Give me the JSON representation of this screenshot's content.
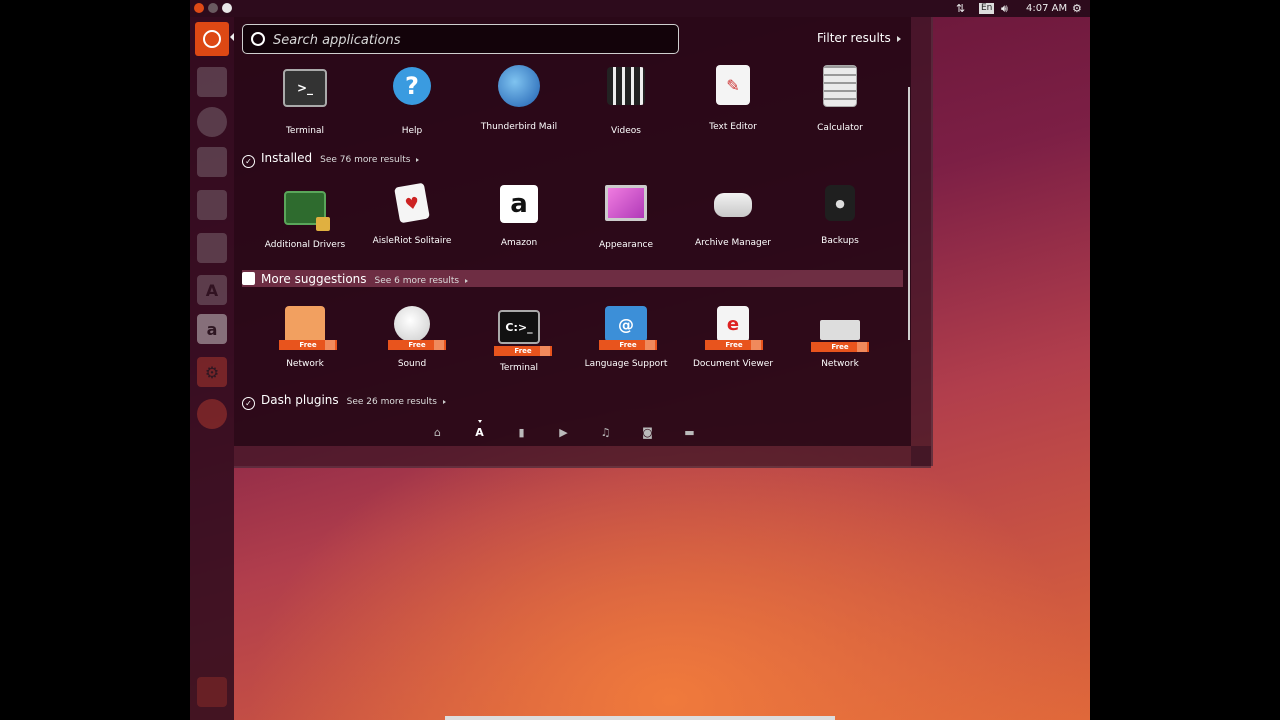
{
  "top_panel": {
    "language": "En",
    "time": "4:07 AM"
  },
  "dash": {
    "search": {
      "placeholder": "Search applications"
    },
    "filter_label": "Filter results",
    "recent_apps": [
      {
        "label": "Terminal",
        "icon": "terminal-icon"
      },
      {
        "label": "Help",
        "icon": "help-icon"
      },
      {
        "label": "Thunderbird Mail",
        "icon": "thunderbird-icon"
      },
      {
        "label": "Videos",
        "icon": "videos-icon"
      },
      {
        "label": "Text Editor",
        "icon": "text-editor-icon"
      },
      {
        "label": "Calculator",
        "icon": "calculator-icon"
      }
    ],
    "installed": {
      "title": "Installed",
      "see_more": "See 76 more results",
      "apps": [
        {
          "label": "Additional Drivers",
          "icon": "chip-icon"
        },
        {
          "label": "AisleRiot Solitaire",
          "icon": "cards-icon"
        },
        {
          "label": "Amazon",
          "icon": "amazon-icon"
        },
        {
          "label": "Appearance",
          "icon": "appearance-icon"
        },
        {
          "label": "Archive Manager",
          "icon": "archive-icon"
        },
        {
          "label": "Backups",
          "icon": "backups-icon"
        }
      ]
    },
    "suggestions": {
      "title": "More suggestions",
      "see_more": "See 6 more results",
      "badge": "Free",
      "apps": [
        {
          "label": "Network",
          "icon": "network-icon"
        },
        {
          "label": "Sound",
          "icon": "sound-icon"
        },
        {
          "label": "Terminal",
          "icon": "terminal-icon"
        },
        {
          "label": "Language Support",
          "icon": "language-icon"
        },
        {
          "label": "Document Viewer",
          "icon": "document-viewer-icon"
        },
        {
          "label": "Network",
          "icon": "network-card-icon"
        }
      ]
    },
    "plugins": {
      "title": "Dash plugins",
      "see_more": "See 26 more results"
    }
  },
  "colors": {
    "ubuntu_orange": "#dd4814",
    "dash_bg": "#260816",
    "free_badge": "#e8541d"
  }
}
